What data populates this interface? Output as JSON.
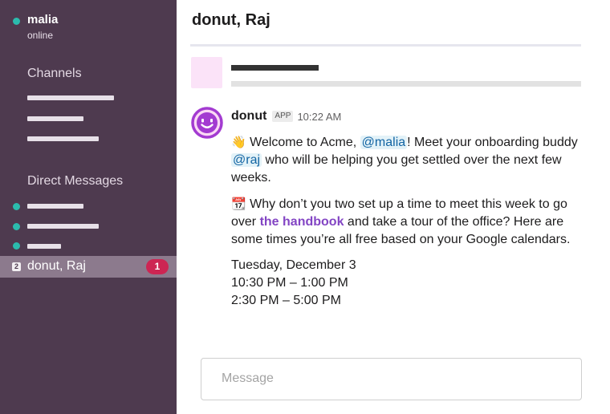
{
  "colors": {
    "sidebar_bg": "#4e3a4f",
    "active_dm_bg": "#8c7a8d",
    "online_dot": "#2bbbad",
    "badge_bg": "#cd2553",
    "link": "#8345c4",
    "mention_bg": "#e3f2f8",
    "bot_avatar": "#a33bd1"
  },
  "sidebar": {
    "user": {
      "name": "malia",
      "status": "online"
    },
    "channels_title": "Channels",
    "dms_title": "Direct Messages",
    "active_dm": {
      "count_icon": "2",
      "label": "donut, Raj",
      "badge": "1"
    }
  },
  "main": {
    "title": "donut, Raj",
    "message": {
      "sender": "donut",
      "app_badge": "APP",
      "time": "10:22 AM",
      "p1": {
        "emoji": "👋",
        "text_a": " Welcome to Acme, ",
        "mention_malia": "@malia",
        "text_b": "! Meet your onboarding buddy ",
        "mention_raj": "@raj",
        "text_c": " who will be helping you get settled over the next few weeks."
      },
      "p2": {
        "emoji": "📆",
        "text_a": " Why don’t you two set up a time to meet this week to go over ",
        "link": "the handbook",
        "text_b": " and take a tour of the office? Here are some times you’re all free based on your Google calendars."
      },
      "date": "Tuesday, December 3",
      "times": [
        "10:30 PM – 1:00 PM",
        "2:30 PM – 5:00 PM"
      ]
    },
    "composer_placeholder": "Message"
  }
}
